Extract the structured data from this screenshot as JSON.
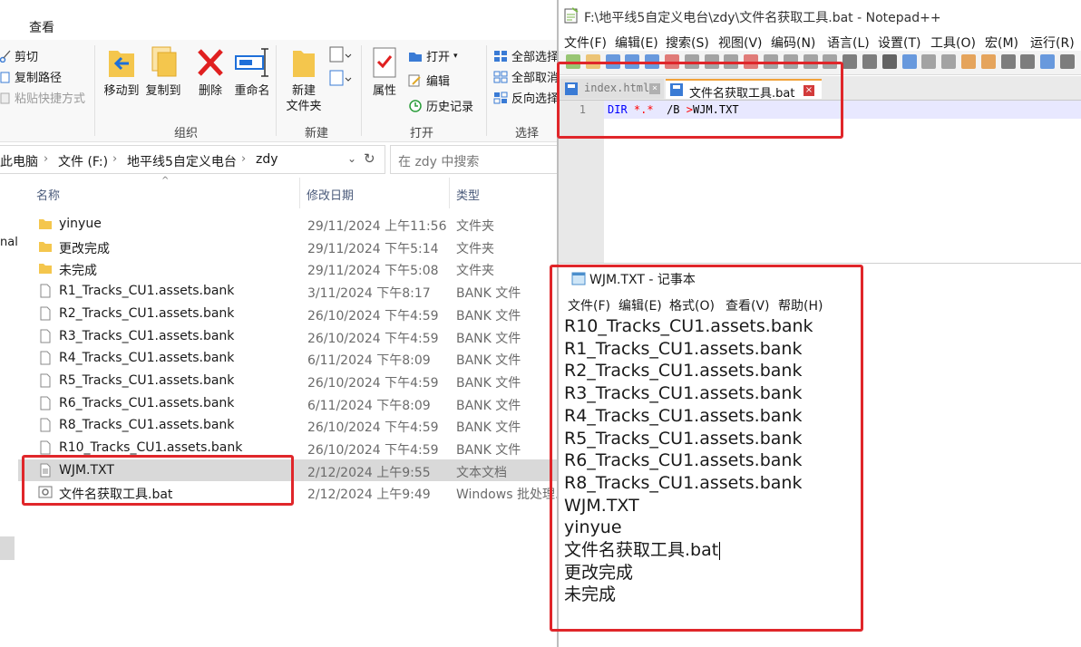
{
  "explorer": {
    "ribbon_tab": "查看",
    "clipboard": {
      "cut": "剪切",
      "copy_path": "复制路径",
      "paste_shortcut": "粘贴快捷方式"
    },
    "organize": {
      "move_to": "移动到",
      "copy_to": "复制到",
      "delete": "删除",
      "rename": "重命名",
      "label": "组织"
    },
    "new": {
      "new_folder_line1": "新建",
      "new_folder_line2": "文件夹",
      "label": "新建"
    },
    "open": {
      "properties": "属性",
      "open": "打开",
      "edit": "编辑",
      "history": "历史记录",
      "label": "打开"
    },
    "select": {
      "select_all": "全部选择",
      "select_none": "全部取消",
      "invert": "反向选择",
      "label": "选择"
    },
    "address": {
      "crumbs": [
        "此电脑",
        "文件 (F:)",
        "地平线5自定义电台",
        "zdy"
      ]
    },
    "search_placeholder": "在 zdy 中搜索",
    "nav_partial": "nal",
    "columns": {
      "name": "名称",
      "date": "修改日期",
      "type": "类型"
    },
    "files": [
      {
        "name": "yinyue",
        "date": "29/11/2024 上午11:56",
        "type": "文件夹",
        "icon": "folder"
      },
      {
        "name": "更改完成",
        "date": "29/11/2024 下午5:14",
        "type": "文件夹",
        "icon": "folder"
      },
      {
        "name": "未完成",
        "date": "29/11/2024 下午5:08",
        "type": "文件夹",
        "icon": "folder"
      },
      {
        "name": "R1_Tracks_CU1.assets.bank",
        "date": "3/11/2024 下午8:17",
        "type": "BANK 文件",
        "icon": "file"
      },
      {
        "name": "R2_Tracks_CU1.assets.bank",
        "date": "26/10/2024 下午4:59",
        "type": "BANK 文件",
        "icon": "file"
      },
      {
        "name": "R3_Tracks_CU1.assets.bank",
        "date": "26/10/2024 下午4:59",
        "type": "BANK 文件",
        "icon": "file"
      },
      {
        "name": "R4_Tracks_CU1.assets.bank",
        "date": "6/11/2024 下午8:09",
        "type": "BANK 文件",
        "icon": "file"
      },
      {
        "name": "R5_Tracks_CU1.assets.bank",
        "date": "26/10/2024 下午4:59",
        "type": "BANK 文件",
        "icon": "file"
      },
      {
        "name": "R6_Tracks_CU1.assets.bank",
        "date": "6/11/2024 下午8:09",
        "type": "BANK 文件",
        "icon": "file"
      },
      {
        "name": "R8_Tracks_CU1.assets.bank",
        "date": "26/10/2024 下午4:59",
        "type": "BANK 文件",
        "icon": "file"
      },
      {
        "name": "R10_Tracks_CU1.assets.bank",
        "date": "26/10/2024 下午4:59",
        "type": "BANK 文件",
        "icon": "file"
      },
      {
        "name": "WJM.TXT",
        "date": "2/12/2024 上午9:55",
        "type": "文本文档",
        "icon": "text",
        "selected": true
      },
      {
        "name": "文件名获取工具.bat",
        "date": "2/12/2024 上午9:49",
        "type": "Windows 批处理...",
        "icon": "bat"
      }
    ]
  },
  "npp": {
    "title": "F:\\地平线5自定义电台\\zdy\\文件名获取工具.bat - Notepad++",
    "menu": [
      "文件(F)",
      "编辑(E)",
      "搜索(S)",
      "视图(V)",
      "编码(N)",
      "语言(L)",
      "设置(T)",
      "工具(O)",
      "宏(M)",
      "运行(R)"
    ],
    "tabs": {
      "inactive": "index.html",
      "active": "文件名获取工具.bat"
    },
    "line_number": "1",
    "code": {
      "kw": "DIR",
      "op1": "*.*",
      "arg": "/B",
      "op2": ">",
      "target": "WJM.TXT"
    }
  },
  "notepad": {
    "title": "WJM.TXT - 记事本",
    "menu": [
      "文件(F)",
      "编辑(E)",
      "格式(O)",
      "查看(V)",
      "帮助(H)"
    ],
    "lines": [
      "R10_Tracks_CU1.assets.bank",
      "R1_Tracks_CU1.assets.bank",
      "R2_Tracks_CU1.assets.bank",
      "R3_Tracks_CU1.assets.bank",
      "R4_Tracks_CU1.assets.bank",
      "R5_Tracks_CU1.assets.bank",
      "R6_Tracks_CU1.assets.bank",
      "R8_Tracks_CU1.assets.bank",
      "WJM.TXT",
      "yinyue",
      "文件名获取工具.bat",
      "更改完成",
      "未完成"
    ]
  },
  "colors": {
    "highlight_box": "#e0262a",
    "selected_row": "#d9d9d9",
    "npp_keyword": "#0000ff",
    "npp_operator": "#ff0000"
  }
}
